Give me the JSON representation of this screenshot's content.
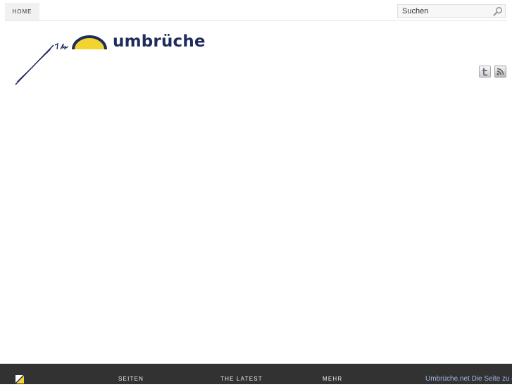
{
  "header": {
    "nav": {
      "home_label": "HOME"
    },
    "search": {
      "value": "Suchen"
    }
  },
  "logo": {
    "text": "umbrüche"
  },
  "social": {
    "icons": [
      "twitter-icon",
      "rss-icon"
    ]
  },
  "footer": {
    "columns": [
      "SEITEN",
      "THE LATEST",
      "MEHR"
    ],
    "text": "Umbrüche.net Die Seite zu den"
  },
  "colors": {
    "brand_navy": "#1d2c5a",
    "brand_yellow": "#f2d431",
    "footer_bg": "#323232",
    "footer_link": "#9fb4e2"
  }
}
